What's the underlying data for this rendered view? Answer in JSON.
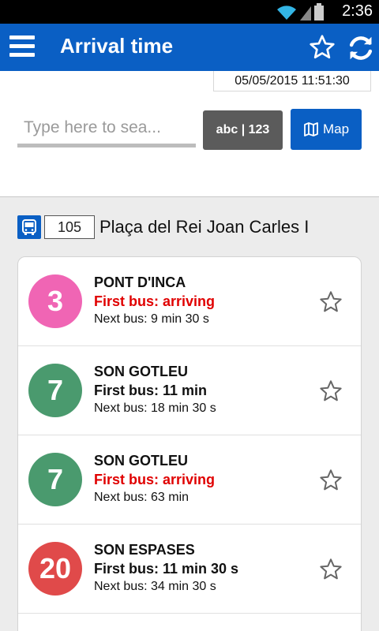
{
  "status_bar": {
    "time": "2:36"
  },
  "header": {
    "title": "Arrival time"
  },
  "timestamp": "05/05/2015 11:51:30",
  "search": {
    "placeholder": "Type here to sea..."
  },
  "keyboard_toggle_label": "abc | 123",
  "map_button_label": "Map",
  "stop": {
    "code": "105",
    "name": "Plaça del Rei Joan Carles I"
  },
  "arrivals": [
    {
      "line": "3",
      "destination": "PONT D'INCA",
      "first": "First bus: arriving",
      "next": "Next bus: 9 min 30 s",
      "color": "#f065b4",
      "first_color": "red"
    },
    {
      "line": "7",
      "destination": "SON GOTLEU",
      "first": "First bus: 11 min",
      "next": "Next bus: 18 min 30 s",
      "color": "#4a9a6e",
      "first_color": "black"
    },
    {
      "line": "7",
      "destination": "SON GOTLEU",
      "first": "First bus: arriving",
      "next": "Next bus: 63 min",
      "color": "#4a9a6e",
      "first_color": "red"
    },
    {
      "line": "20",
      "destination": "SON ESPASES",
      "first": "First bus: 11 min 30 s",
      "next": "Next bus: 34 min 30 s",
      "color": "#e04a4a",
      "first_color": "black"
    }
  ],
  "colors": {
    "brand": "#0a5fc4",
    "arriving": "#e00000"
  }
}
